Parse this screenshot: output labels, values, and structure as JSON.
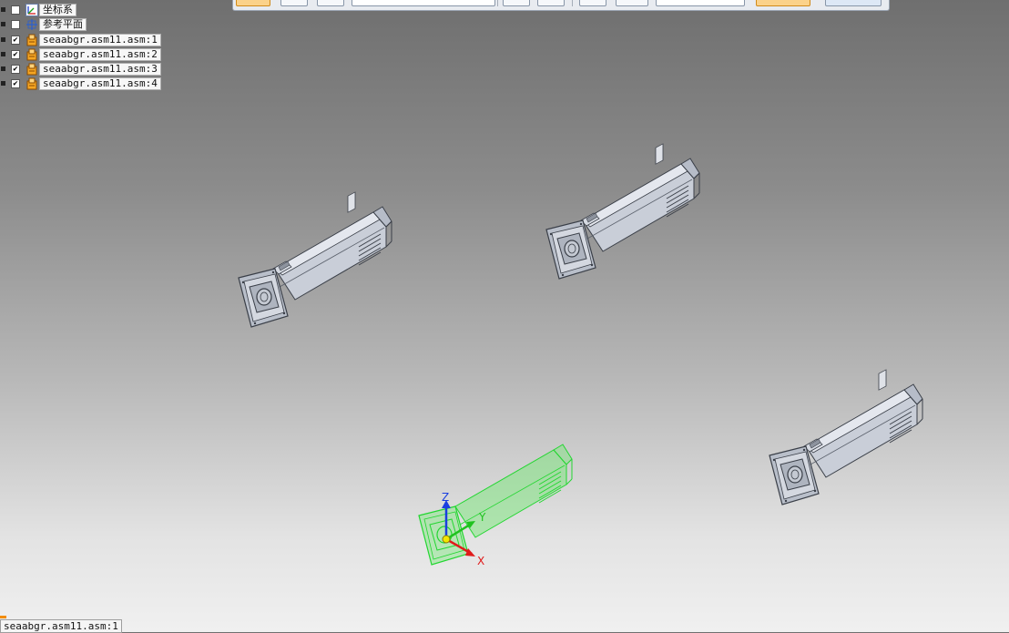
{
  "tree": {
    "items": [
      {
        "label": "坐标系",
        "checked": false,
        "icon": "coordinate-system-icon"
      },
      {
        "label": "参考平面",
        "checked": false,
        "icon": "reference-plane-icon"
      },
      {
        "label": "seaabgr.asm11.asm:1",
        "checked": true,
        "icon": "assembly-part-icon"
      },
      {
        "label": "seaabgr.asm11.asm:2",
        "checked": true,
        "icon": "assembly-part-icon"
      },
      {
        "label": "seaabgr.asm11.asm:3",
        "checked": true,
        "icon": "assembly-part-icon"
      },
      {
        "label": "seaabgr.asm11.asm:4",
        "checked": true,
        "icon": "assembly-part-icon"
      }
    ]
  },
  "status": {
    "text": "seaabgr.asm11.asm:1"
  },
  "triad": {
    "x": "X",
    "y": "Y",
    "z": "Z"
  },
  "colors": {
    "selected": "#22d630",
    "part": "#c4c9d4",
    "edge": "#3a3f48",
    "accent": "#f28c00"
  }
}
